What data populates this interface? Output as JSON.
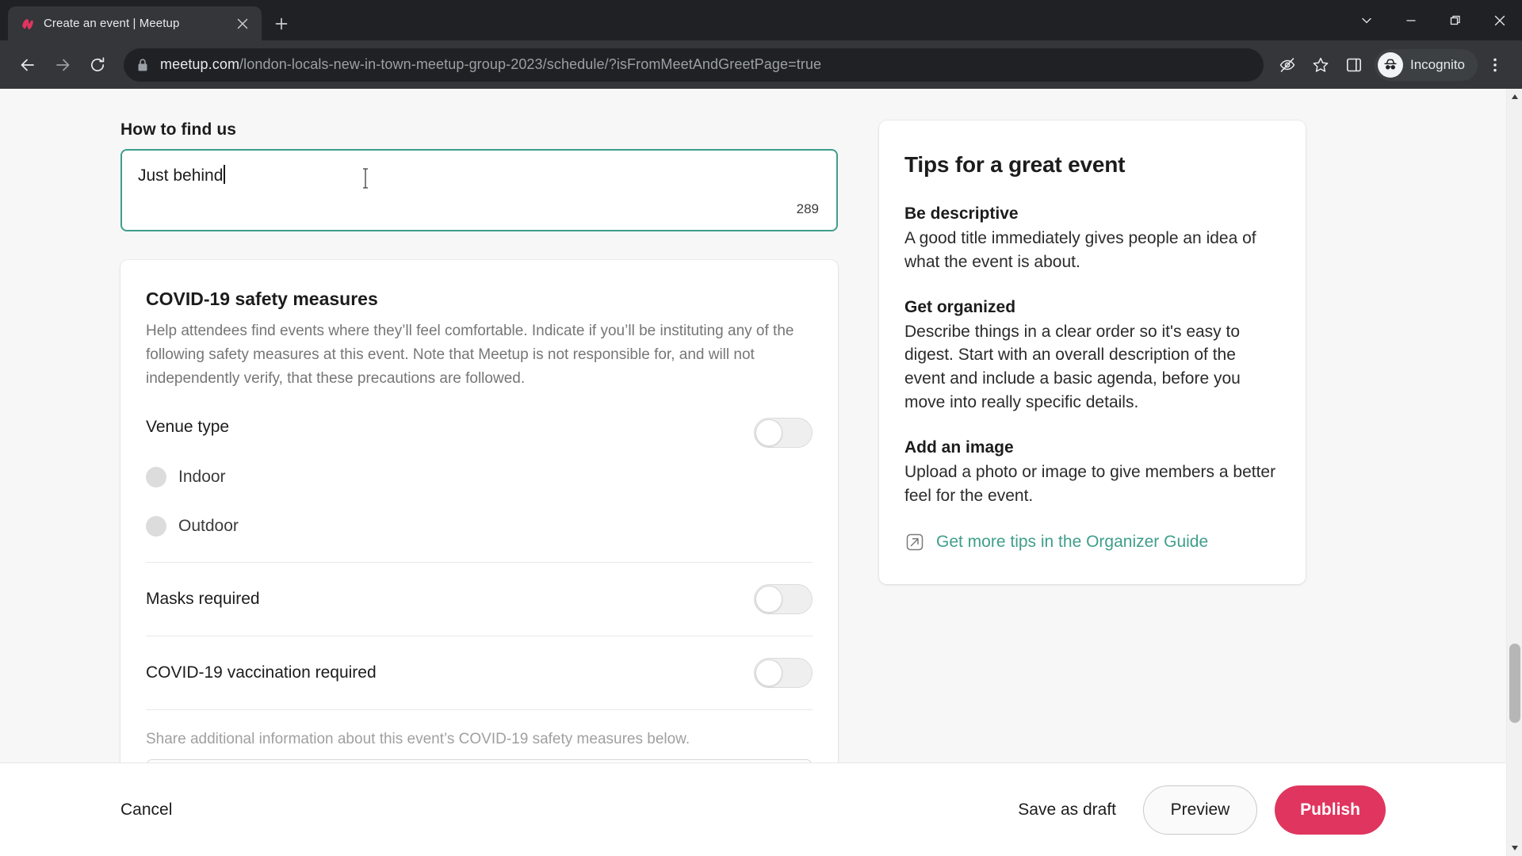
{
  "browser": {
    "tab": {
      "title": "Create an event | Meetup",
      "favicon": "meetup-logo-icon",
      "close": "close-icon"
    },
    "newtab_icon": "plus-icon",
    "window_controls": {
      "tab_search": "chevron-down-icon",
      "minimize": "minimize-icon",
      "restore": "restore-icon",
      "close": "close-icon"
    },
    "nav": {
      "back": "back-arrow-icon",
      "forward": "forward-arrow-icon",
      "reload": "reload-icon"
    },
    "omnibox": {
      "lock_icon": "lock-icon",
      "url_domain": "meetup.com",
      "url_path": "/london-locals-new-in-town-meetup-group-2023/schedule/?isFromMeetAndGreetPage=true"
    },
    "toolbar_icons": {
      "cookies": "eye-slash-icon",
      "bookmark": "star-icon",
      "side_panel": "side-panel-icon",
      "menu": "three-dot-menu-icon"
    },
    "profile": {
      "label": "Incognito",
      "avatar": "incognito-avatar-icon"
    }
  },
  "form": {
    "how_to_find_us": {
      "label": "How to find us",
      "value": "Just behind",
      "char_count": "289"
    },
    "covid": {
      "title": "COVID-19 safety measures",
      "description": "Help attendees find events where they’ll feel comfortable. Indicate if you’ll be instituting any of the following safety measures at this event. Note that Meetup is not responsible for, and will not independently verify, that these precautions are followed.",
      "venue_type": {
        "label": "Venue type",
        "options": [
          {
            "label": "Indoor"
          },
          {
            "label": "Outdoor"
          }
        ]
      },
      "masks": {
        "label": "Masks required"
      },
      "vaccination": {
        "label": "COVID-19 vaccination required"
      },
      "helper": "Share additional information about this event’s COVID-19 safety measures below."
    }
  },
  "tips": {
    "title": "Tips for a great event",
    "items": [
      {
        "heading": "Be descriptive",
        "body": "A good title immediately gives people an idea of what the event is about."
      },
      {
        "heading": "Get organized",
        "body": "Describe things in a clear order so it's easy to digest. Start with an overall description of the event and include a basic agenda, before you move into really specific details."
      },
      {
        "heading": "Add an image",
        "body": "Upload a photo or image to give members a better feel for the event."
      }
    ],
    "link": {
      "text": "Get more tips in the Organizer Guide",
      "icon": "external-link-icon"
    }
  },
  "actions": {
    "cancel": "Cancel",
    "save_draft": "Save as draft",
    "preview": "Preview",
    "publish": "Publish"
  },
  "colors": {
    "accent_teal": "#3f9e8b",
    "publish_red": "#e0355e",
    "chrome_dark": "#202124"
  }
}
